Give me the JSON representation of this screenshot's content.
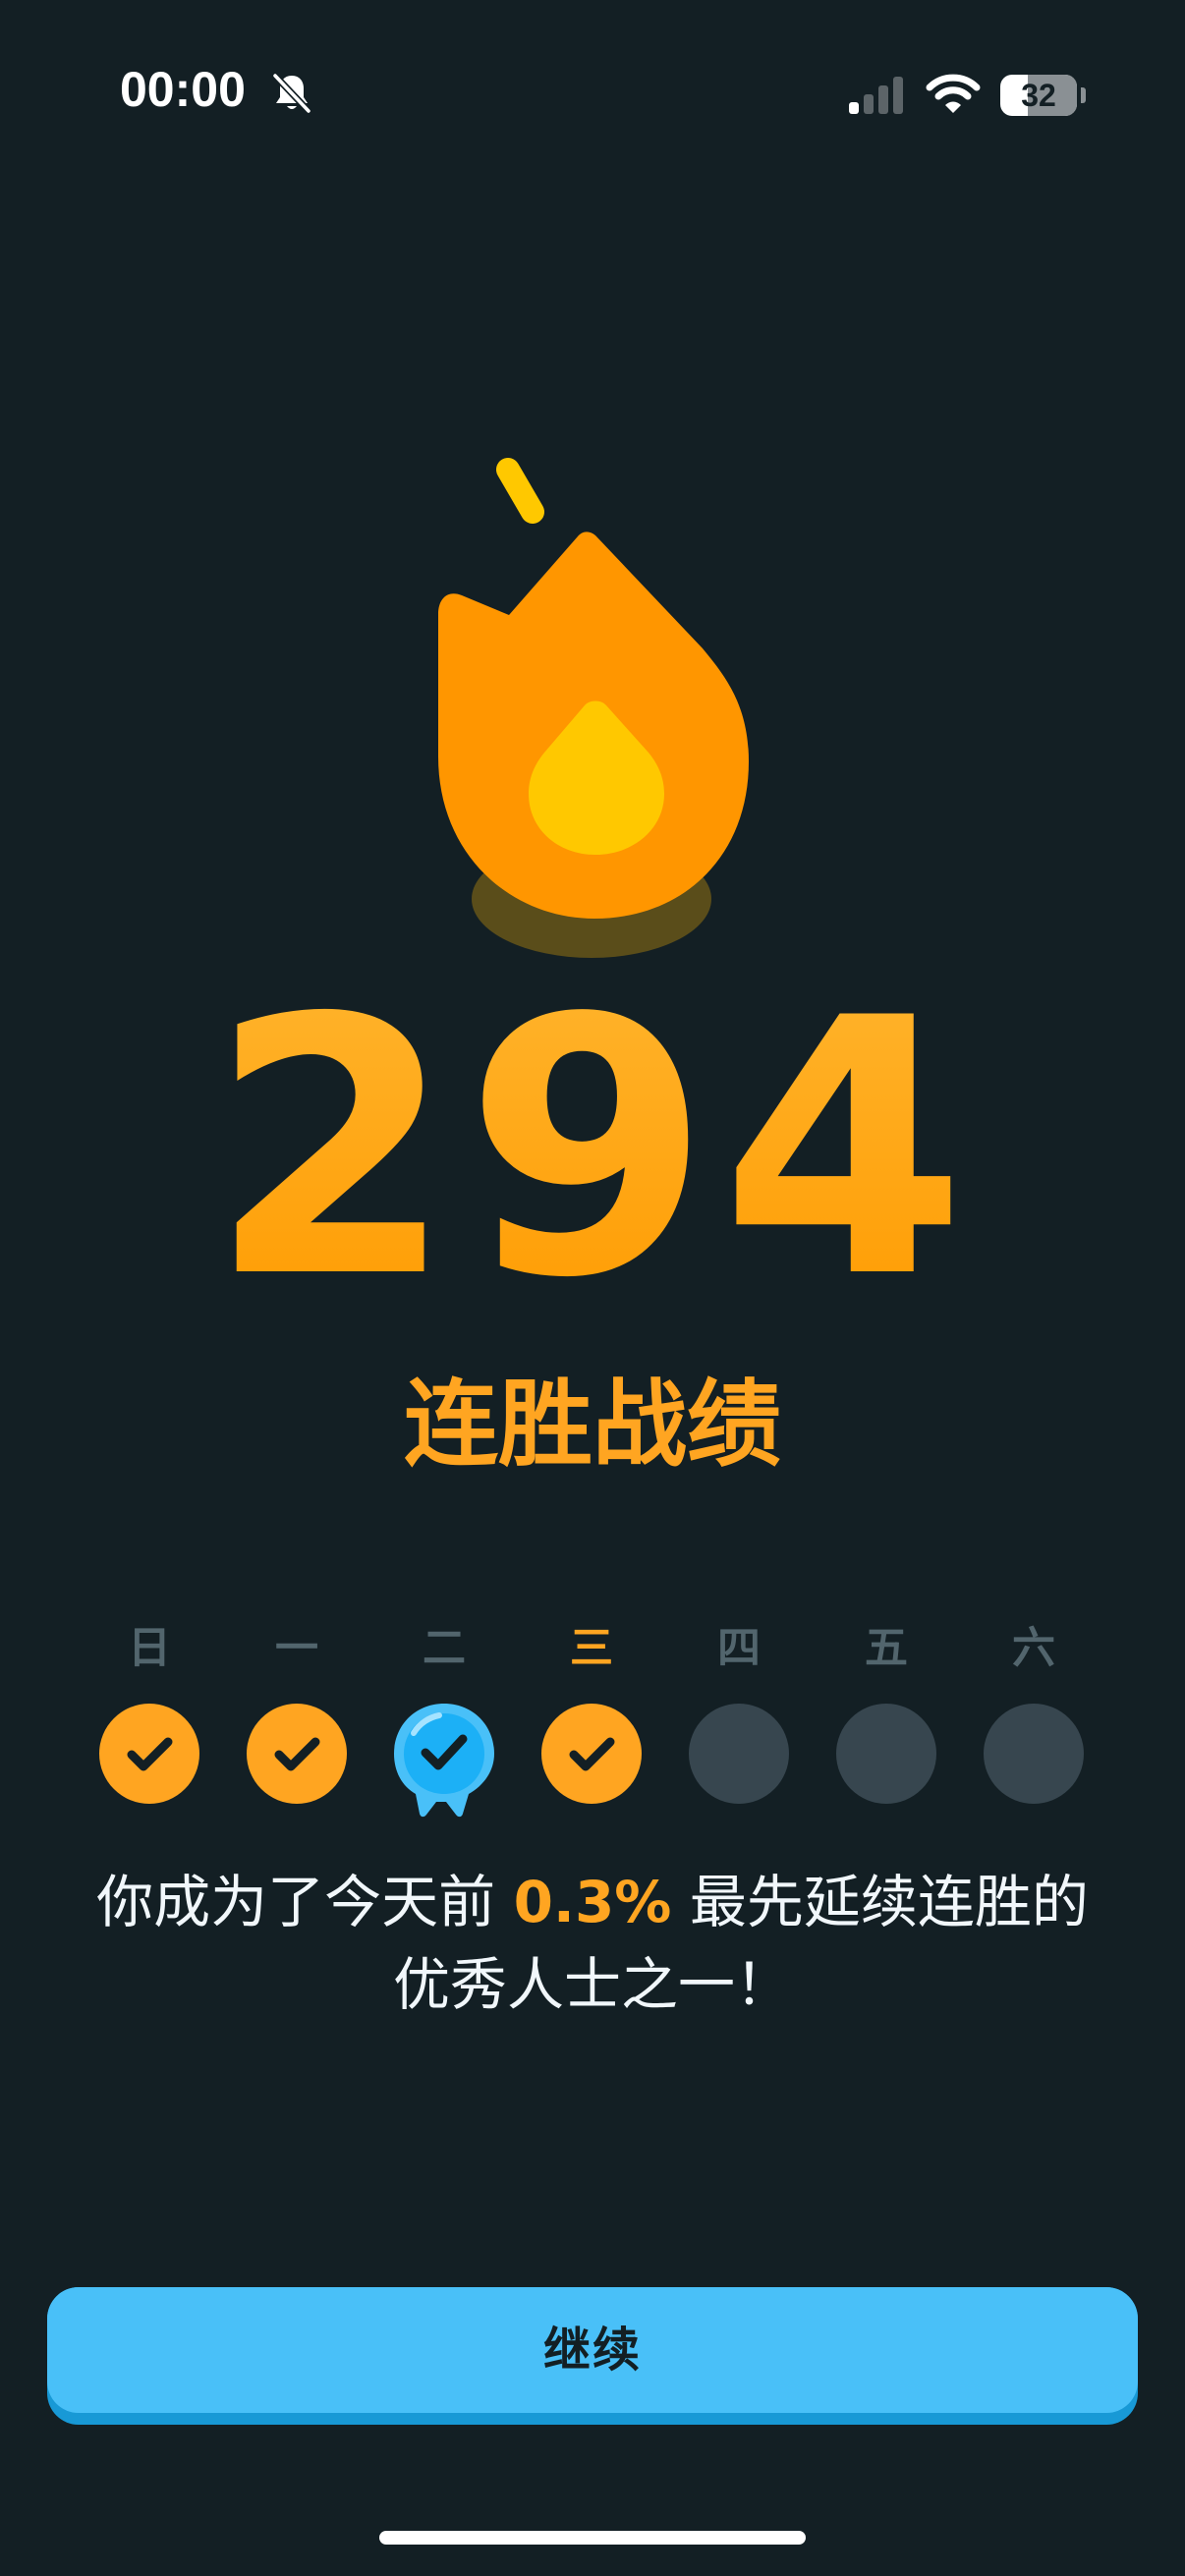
{
  "status_bar": {
    "time": "00:00",
    "silent_icon": "bell-slash-icon",
    "signal_icon": "cellular-signal-icon",
    "wifi_icon": "wifi-icon",
    "battery_level": "32"
  },
  "flame_icon": "streak-flame-icon",
  "streak": {
    "count": "294",
    "label": "连胜战绩"
  },
  "week": [
    {
      "label": "日",
      "state": "done"
    },
    {
      "label": "一",
      "state": "done"
    },
    {
      "label": "二",
      "state": "frozen"
    },
    {
      "label": "三",
      "state": "done",
      "today": true
    },
    {
      "label": "四",
      "state": "empty"
    },
    {
      "label": "五",
      "state": "empty"
    },
    {
      "label": "六",
      "state": "empty"
    }
  ],
  "message": {
    "prefix": "你成为了今天前 ",
    "percent": "0.3%",
    "suffix_line1": " 最先延续连胜的",
    "line2": "优秀人士之一！"
  },
  "continue_button": {
    "label": "继续"
  },
  "colors": {
    "background": "#131f24",
    "accent_orange": "#ffa521",
    "button_blue": "#49c0f8",
    "button_shadow": "#1899d6",
    "empty_day": "#37464f",
    "day_label": "#52656d"
  }
}
